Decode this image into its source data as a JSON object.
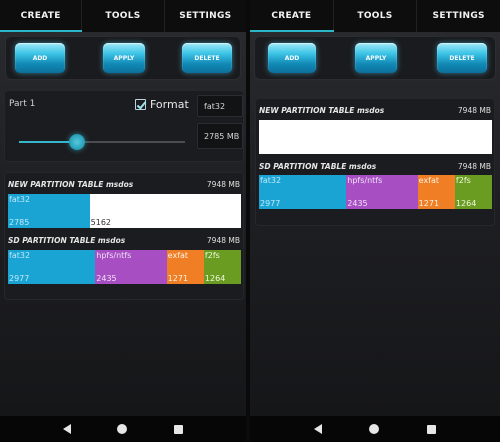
{
  "tabs": [
    "CREATE",
    "TOOLS",
    "SETTINGS"
  ],
  "colors": {
    "accent": "#2bb7c8",
    "fat32": "#1aa4d4",
    "hpfs": "#a64ec2",
    "exfat": "#f07e24",
    "f2fs": "#6a9c22",
    "free": "#ffffff"
  },
  "buttons": {
    "add": "ADD",
    "apply": "APPLY",
    "delete": "DELETE"
  },
  "part": {
    "label": "Part 1",
    "format_label": "Format",
    "format_checked": true,
    "filesystem": "fat32",
    "size": "2785 MB",
    "slider_fraction": 0.35
  },
  "new_table": {
    "title": "NEW PARTITION TABLE msdos",
    "size": "7948 MB",
    "segments": [
      {
        "fs": "fat32",
        "value": "2785",
        "color": "#1aa4d4",
        "text_color": "#bfe8f7"
      },
      {
        "fs": "",
        "value": "5162",
        "color": "#ffffff",
        "text_color": "#333333"
      }
    ]
  },
  "sd_table": {
    "title": "SD PARTITION TABLE msdos",
    "size": "7948 MB",
    "segments": [
      {
        "fs": "fat32",
        "value": "2977",
        "color": "#1aa4d4",
        "text_color": "#bfe8f7"
      },
      {
        "fs": "hpfs/ntfs",
        "value": "2435",
        "color": "#a64ec2",
        "text_color": "#f2e2f8"
      },
      {
        "fs": "exfat",
        "value": "1271",
        "color": "#f07e24",
        "text_color": "#fff1e4"
      },
      {
        "fs": "f2fs",
        "value": "1264",
        "color": "#6a9c22",
        "text_color": "#eef8dd"
      }
    ]
  },
  "right_new_table": {
    "title": "NEW PARTITION TABLE msdos",
    "size": "7948 MB",
    "segments": [
      {
        "fs": "",
        "value": "",
        "color": "#ffffff",
        "text_color": "#333333"
      }
    ]
  },
  "nav": {
    "back": "back-icon",
    "home": "home-icon",
    "recent": "recent-apps-icon"
  }
}
